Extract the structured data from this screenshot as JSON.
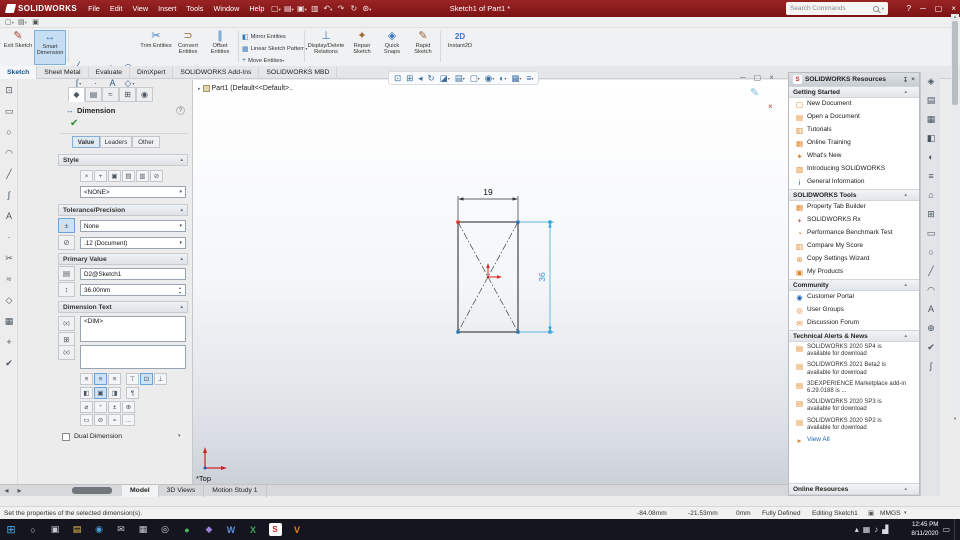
{
  "colors": {
    "titlebar": "#7c1315",
    "taskbar": "#15151f",
    "selected_dimension": "#2b9fd6",
    "origin": "#d42a2a",
    "accent": "#2f7cc0"
  },
  "titlebar": {
    "logo": "SOLIDWORKS",
    "menus": [
      "File",
      "Edit",
      "View",
      "Insert",
      "Tools",
      "Window",
      "Help"
    ],
    "doc_title": "Sketch1 of Part1 *",
    "search_placeholder": "Search Commands"
  },
  "ribbon": {
    "exit_sketch": "Exit Sketch",
    "smart_dimension": "Smart Dimension",
    "trim": "Trim Entities",
    "convert": "Convert Entities",
    "offset": "Offset Entities",
    "mirror": "Mirror Entities",
    "linear_pattern": "Linear Sketch Pattern",
    "move": "Move Entities",
    "display_delete": "Display/Delete Relations",
    "repair": "Repair Sketch",
    "quick_snaps": "Quick Snaps",
    "rapid": "Rapid Sketch",
    "instant2d": "Instant2D"
  },
  "command_tabs": [
    "Sketch",
    "Sheet Metal",
    "Evaluate",
    "DimXpert",
    "SOLIDWORKS Add-Ins",
    "SOLIDWORKS MBD"
  ],
  "pm": {
    "title": "Dimension",
    "value_tabs": [
      "Value",
      "Leaders",
      "Other"
    ],
    "style": {
      "header": "Style",
      "selected": "<NONE>"
    },
    "tolerance": {
      "header": "Tolerance/Precision",
      "type": "None",
      "precision": ".12 (Document)"
    },
    "primary": {
      "header": "Primary Value",
      "name": "D2@Sketch1",
      "value": "36.00mm"
    },
    "dim_text": {
      "header": "Dimension Text",
      "text": "<DIM>"
    },
    "dual": {
      "label": "Dual Dimension"
    }
  },
  "viewport": {
    "part_label": "Part1 (Default<<Default>..",
    "view_label": "*Top",
    "dim_width": "19",
    "dim_height": "36"
  },
  "taskpane": {
    "title": "SOLIDWORKS Resources",
    "sections": [
      {
        "header": "Getting Started",
        "items": [
          "New Document",
          "Open a Document",
          "Tutorials",
          "Online Training",
          "What's New",
          "Introducing SOLIDWORKS",
          "General Information"
        ]
      },
      {
        "header": "SOLIDWORKS Tools",
        "items": [
          "Property Tab Builder",
          "SOLIDWORKS Rx",
          "Performance Benchmark Test",
          "Compare My Score",
          "Copy Settings Wizard",
          "My Products"
        ]
      },
      {
        "header": "Community",
        "items": [
          "Customer Portal",
          "User Groups",
          "Discussion Forum"
        ]
      },
      {
        "header": "Technical Alerts & News",
        "items": [
          "SOLIDWORKS 2020 SP4 is available for download",
          "SOLIDWORKS 2021 Beta2 is available for download",
          "3DEXPERIENCE Marketplace add-in 6.29.0188 is ...",
          "SOLIDWORKS 2020 SP3 is available for download",
          "SOLIDWORKS 2020 SP2 is available for download",
          "View All"
        ]
      },
      {
        "header": "Online Resources",
        "items": []
      }
    ]
  },
  "dock_tabs": [
    "Model",
    "3D Views",
    "Motion Study 1"
  ],
  "statusbar": {
    "message": "Set the properties of the selected dimension(s).",
    "x": "-84.08mm",
    "y": "-21.53mm",
    "z": "0mm",
    "state": "Fully Defined",
    "editing": "Editing Sketch1",
    "units": "MMGS"
  },
  "taskbar": {
    "time": "12:45 PM",
    "date": "8/11/2020"
  }
}
